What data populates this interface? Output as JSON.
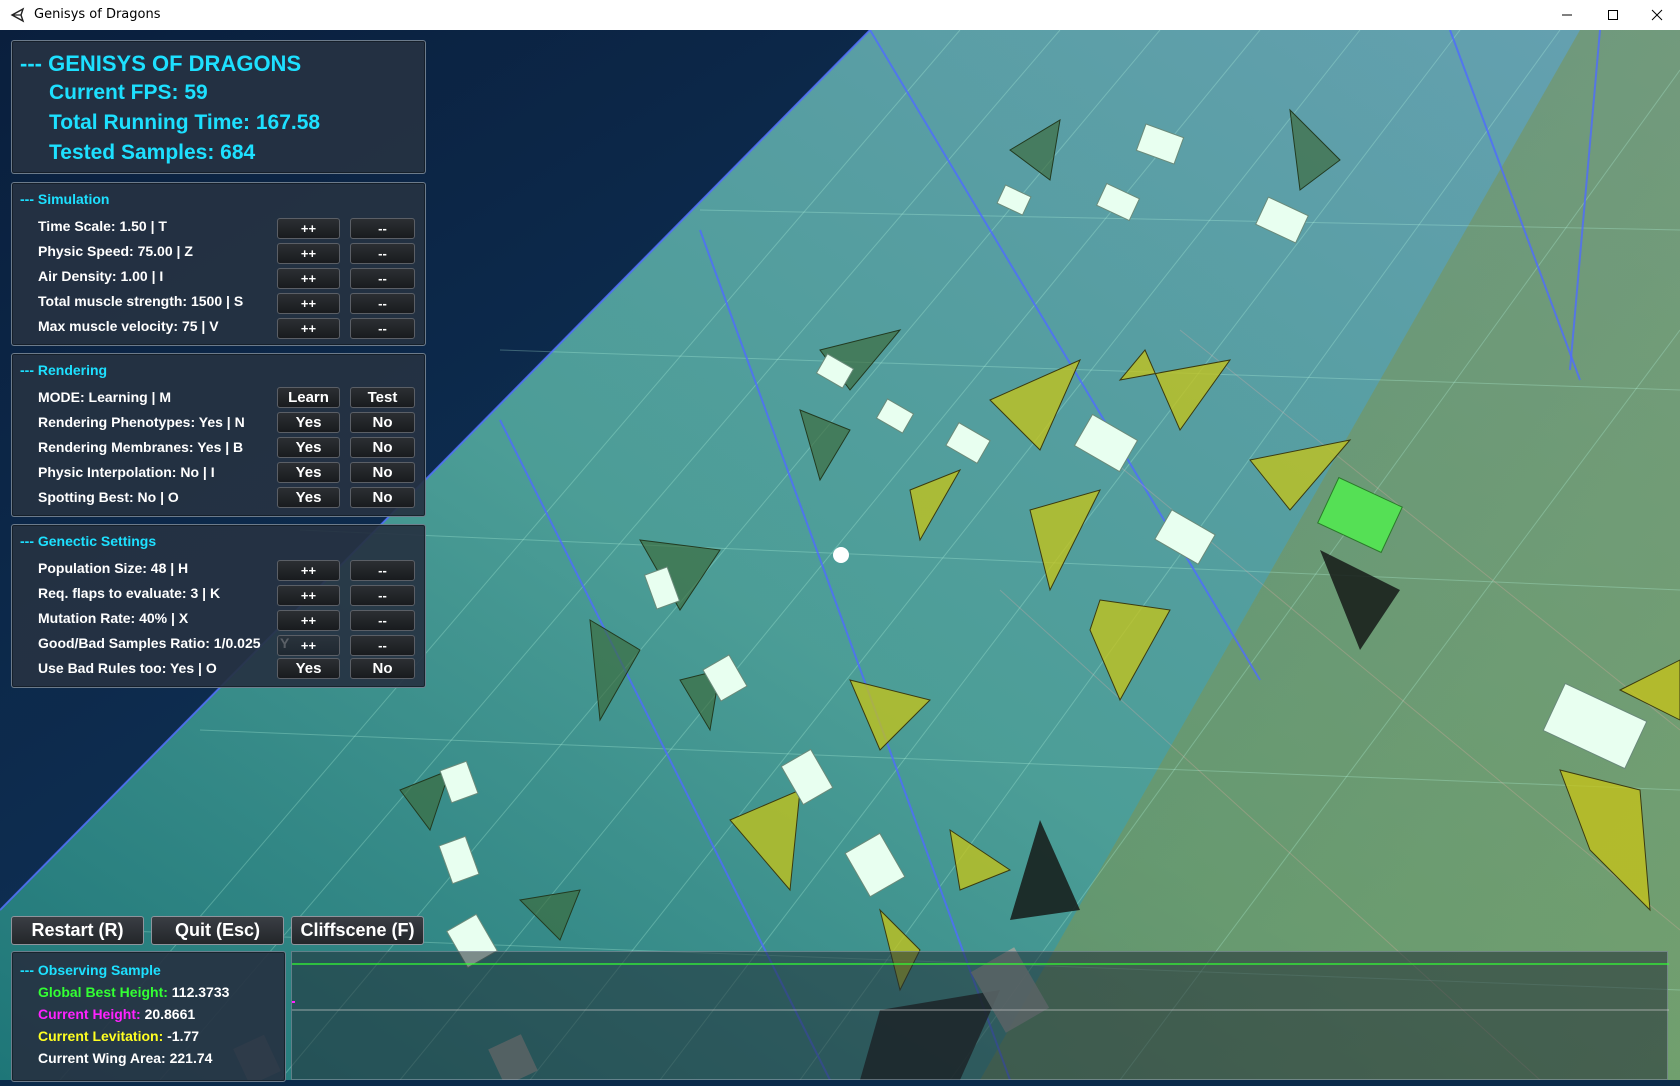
{
  "window": {
    "title": "Genisys of Dragons"
  },
  "stats": {
    "title": "--- GENISYS OF DRAGONS",
    "fps": "Current FPS: 59",
    "running_time": "Total Running Time: 167.58",
    "tested_samples": "Tested Samples: 684"
  },
  "simulation": {
    "title": "--- Simulation",
    "rows": [
      {
        "label": "Time Scale: 1.50 | T",
        "btn1": "++",
        "btn2": "--"
      },
      {
        "label": "Physic Speed: 75.00 | Z",
        "btn1": "++",
        "btn2": "--"
      },
      {
        "label": "Air Density: 1.00 | I",
        "btn1": "++",
        "btn2": "--"
      },
      {
        "label": "Total muscle strength: 1500 | S",
        "btn1": "++",
        "btn2": "--"
      },
      {
        "label": "Max muscle velocity: 75 | V",
        "btn1": "++",
        "btn2": "--"
      }
    ]
  },
  "rendering": {
    "title": "--- Rendering",
    "rows": [
      {
        "label": "MODE: Learning | M",
        "btn1": "Learn",
        "btn2": "Test"
      },
      {
        "label": "Rendering Phenotypes: Yes | N",
        "btn1": "Yes",
        "btn2": "No"
      },
      {
        "label": "Rendering Membranes: Yes | B",
        "btn1": "Yes",
        "btn2": "No"
      },
      {
        "label": "Physic Interpolation: No | I",
        "btn1": "Yes",
        "btn2": "No"
      },
      {
        "label": "Spotting Best: No | O",
        "btn1": "Yes",
        "btn2": "No"
      }
    ]
  },
  "genetic": {
    "title": "--- Genectic Settings",
    "rows": [
      {
        "label": "Population Size: 48 | H",
        "btn1": "++",
        "btn2": "--"
      },
      {
        "label": "Req. flaps to evaluate: 3 | K",
        "btn1": "++",
        "btn2": "--"
      },
      {
        "label": "Mutation Rate: 40% | X",
        "btn1": "++",
        "btn2": "--"
      },
      {
        "label": "Good/Bad Samples Ratio: 1/0.025",
        "btn1": "++",
        "btn2": "--",
        "hidden_key": "Y"
      },
      {
        "label": "Use Bad Rules too: Yes | O",
        "btn1": "Yes",
        "btn2": "No"
      }
    ]
  },
  "actions": {
    "restart": "Restart (R)",
    "quit": "Quit (Esc)",
    "cliffscene": "Cliffscene (F)"
  },
  "observing": {
    "title": "--- Observing Sample",
    "global_best_label": "Global Best Height:",
    "global_best_value": "112.3733",
    "current_height_label": "Current Height:",
    "current_height_value": "20.8661",
    "levitation_label": "Current Levitation:",
    "levitation_value": "-1.77",
    "wing_area_label": "Current Wing Area:",
    "wing_area_value": "221.74"
  },
  "colors": {
    "header_cyan": "#1de0ff",
    "global_best_green": "#33ff33",
    "current_height_magenta": "#ff22ff",
    "levitation_yellow": "#ffff22"
  }
}
